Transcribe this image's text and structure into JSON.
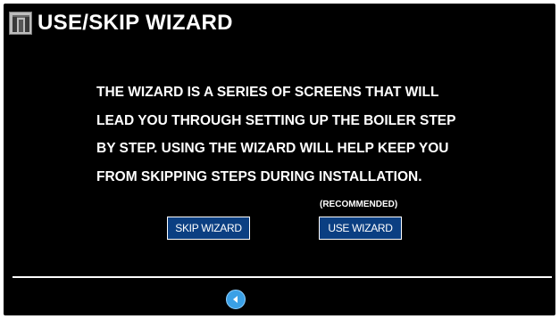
{
  "header": {
    "logo_icon": "manufacturer-logo-icon",
    "title": "USE/SKIP WIZARD"
  },
  "main": {
    "description_lines": [
      "THE WIZARD IS A SERIES OF SCREENS THAT WILL",
      "LEAD YOU THROUGH SETTING UP THE BOILER STEP",
      "BY STEP. USING THE WIZARD WILL HELP KEEP YOU",
      "FROM SKIPPING STEPS DURING INSTALLATION."
    ],
    "recommended_label": "(RECOMMENDED)",
    "skip_button_label": "SKIP WIZARD",
    "use_button_label": "USE WIZARD"
  },
  "footer": {
    "back_icon": "back-arrow-icon"
  },
  "colors": {
    "background": "#000000",
    "text": "#ffffff",
    "button": "#0b3f82",
    "back_button": "#3aa0e6"
  }
}
